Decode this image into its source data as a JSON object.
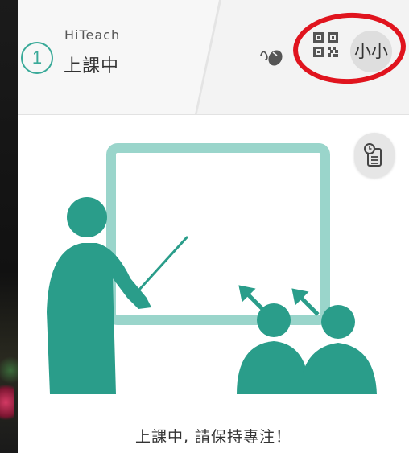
{
  "header": {
    "session_number": "1",
    "app_name": "HiTeach",
    "status_title": "上課中",
    "avatar_label": "小小"
  },
  "icons": {
    "status": "mouse-icon",
    "qr": "qr-code-icon",
    "clipboard": "clipboard-clock-icon"
  },
  "main": {
    "hint_text": "上課中, 請保持專注！"
  },
  "colors": {
    "accent": "#3aaa99",
    "illustration_primary": "#2a9d8a",
    "illustration_light": "#9ad5cb",
    "highlight_ring": "#e0141e",
    "header_bg": "#f3f3f3",
    "avatar_bg": "#dedede"
  }
}
